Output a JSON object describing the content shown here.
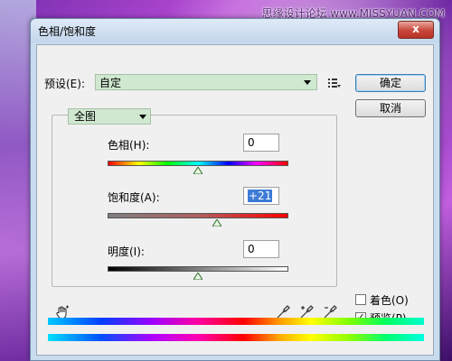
{
  "watermark": "思缘设计论坛 www.MISSYUAN.COM",
  "window": {
    "title": "色相/饱和度",
    "close_glyph": "x"
  },
  "preset": {
    "label": "预设(E):",
    "value": "自定"
  },
  "buttons": {
    "ok": "确定",
    "cancel": "取消"
  },
  "channel": {
    "value": "全图"
  },
  "sliders": [
    {
      "label": "色相(H):",
      "value": "0",
      "fraction": 0.5
    },
    {
      "label": "饱和度(A):",
      "value": "+21",
      "fraction": 0.605
    },
    {
      "label": "明度(I):",
      "value": "0",
      "fraction": 0.5
    }
  ],
  "options": {
    "colorize": {
      "label": "着色(O)",
      "checked": false
    },
    "preview": {
      "label": "预览(P)",
      "checked": true,
      "mark": "✓"
    }
  },
  "colors": {
    "accent": "#3d7bd6",
    "preset_bg": "#cfe8cf"
  }
}
